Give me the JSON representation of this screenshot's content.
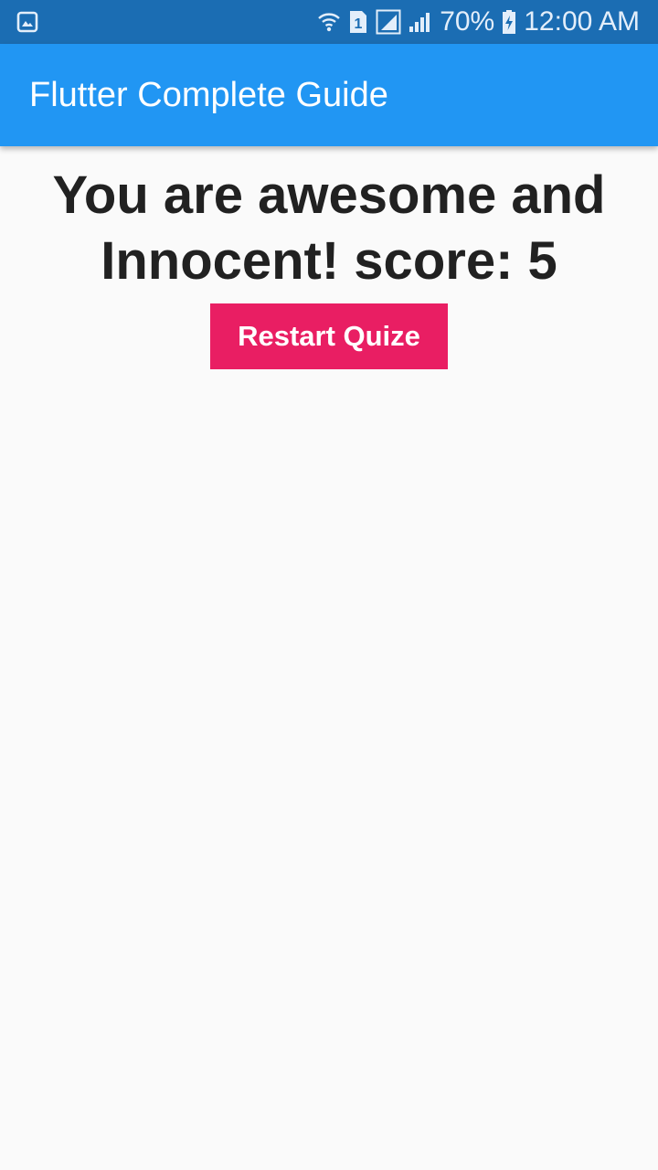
{
  "status_bar": {
    "battery_text": "70%",
    "time": "12:00 AM",
    "sim_label": "1",
    "icons": [
      "gallery-icon",
      "wifi-icon",
      "sim-icon",
      "signal-icon",
      "signal-icon",
      "battery-charging-icon"
    ]
  },
  "app_bar": {
    "title": "Flutter Complete Guide"
  },
  "result": {
    "message": "You are awesome and Innocent! score: 5"
  },
  "actions": {
    "restart_label": "Restart Quize"
  },
  "colors": {
    "status_bar": "#1b6db3",
    "app_bar": "#2196f3",
    "button": "#e91e63",
    "background": "#fafafa",
    "text": "#212121"
  }
}
